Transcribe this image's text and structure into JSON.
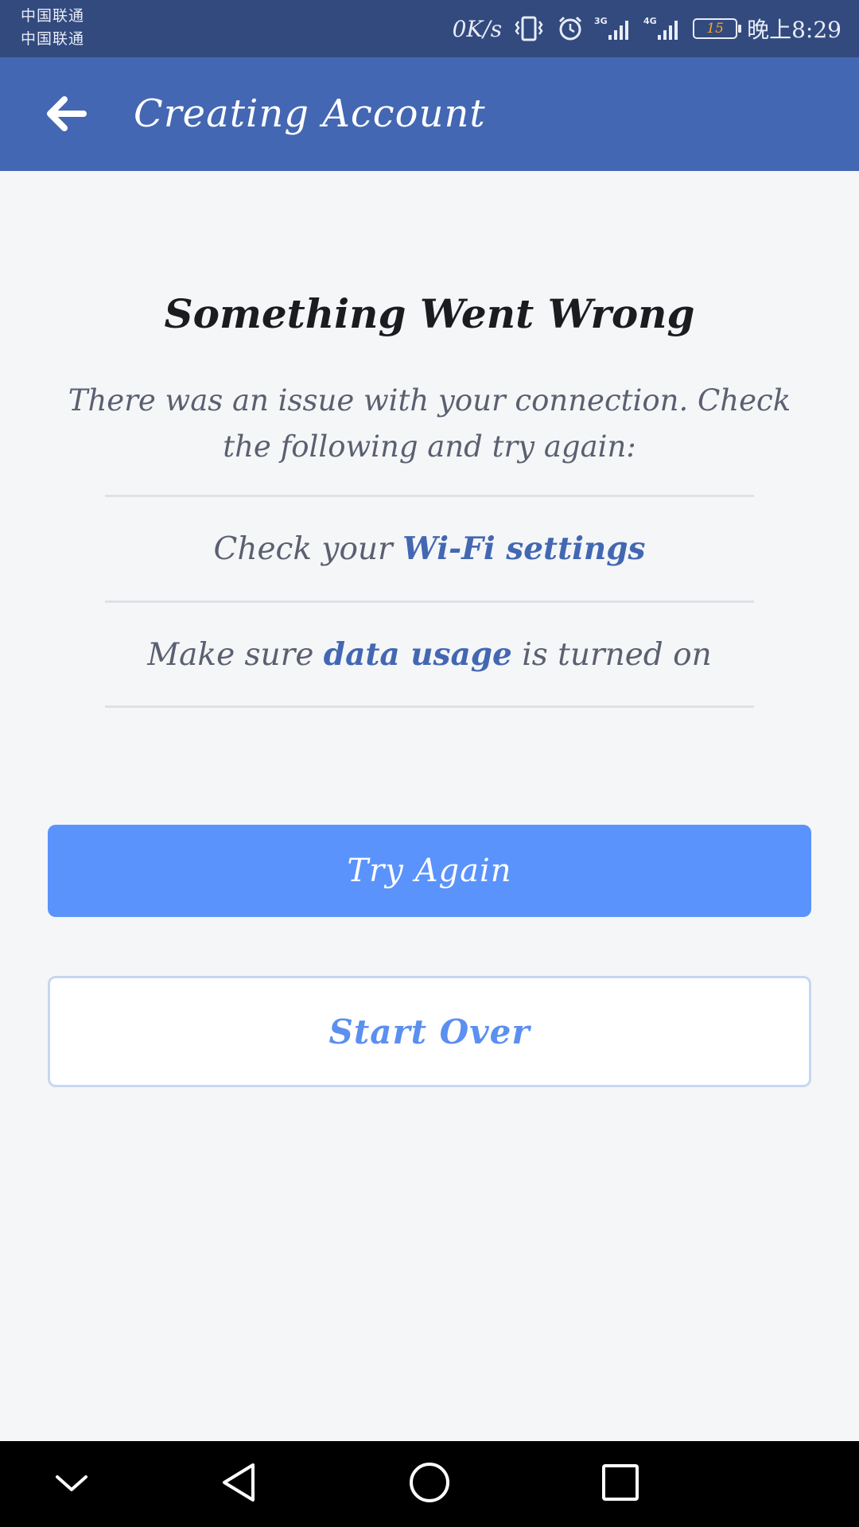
{
  "status_bar": {
    "carrier_1": "中国联通",
    "carrier_2": "中国联通",
    "net_speed": "0K/s",
    "network_1": "3G",
    "network_2": "4G",
    "battery_level": "15",
    "time": "晚上8:29",
    "icons": [
      "vibrate-icon",
      "alarm-icon",
      "signal-3g-icon",
      "signal-4g-icon",
      "battery-icon"
    ]
  },
  "app_bar": {
    "back_icon": "arrow-left-icon",
    "title": "Creating Account",
    "background_color": "#4367b2"
  },
  "error": {
    "title": "Something Went Wrong",
    "message": "There was an issue with your connection. Check the following and try again:"
  },
  "tips": [
    {
      "prefix": "Check your ",
      "link": "Wi-Fi settings",
      "suffix": ""
    },
    {
      "prefix": "Make sure ",
      "link": "data usage",
      "suffix": " is turned on"
    }
  ],
  "buttons": {
    "try_again": "Try Again",
    "start_over": "Start Over",
    "primary_color": "#5b93fc"
  },
  "nav_bar": {
    "icons": [
      "chevron-down-icon",
      "back-triangle-icon",
      "home-circle-icon",
      "recents-square-icon"
    ]
  }
}
